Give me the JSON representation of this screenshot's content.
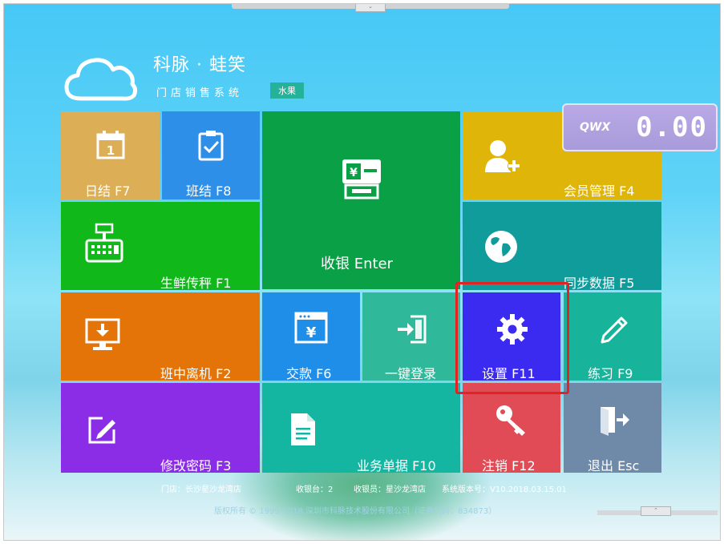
{
  "brand": {
    "title": "科脉 · 蛙笑",
    "subtitle": "门店销售系统",
    "badge": "水果"
  },
  "display": {
    "logo": "QWX",
    "amount": "0.00"
  },
  "tiles": {
    "daily": "日结 F7",
    "shift": "班结 F8",
    "checkout": "收银 Enter",
    "member": "会员管理 F4",
    "scale": "生鲜传秤 F1",
    "sync": "同步数据 F5",
    "leave": "班中离机 F2",
    "payin": "交款 F6",
    "login": "一键登录",
    "settings": "设置 F11",
    "practice": "练习 F9",
    "password": "修改密码 F3",
    "docs": "业务单据 F10",
    "logout": "注销 F12",
    "exit": "退出 Esc"
  },
  "status": {
    "store": "门店：长沙星沙龙湾店",
    "register": "收银台：2",
    "cashier": "收银员：星沙龙湾店",
    "version": "系统版本号：V10.2018.03.15.01"
  },
  "copyright": "版权所有 © 1999-2018 深圳市科脉技术股份有限公司（证券代码：834873）",
  "colors": {
    "daily": "#dcae55",
    "shift": "#2e8fe8",
    "checkout": "#0aa046",
    "member": "#e0b50a",
    "scale": "#10b81a",
    "sync": "#119c9c",
    "leave": "#e47408",
    "payin": "#1f8ee8",
    "login": "#30b89a",
    "settings": "#3b2bf0",
    "practice": "#17b39a",
    "password": "#8b2de6",
    "docs": "#14b6a2",
    "logout": "#e04b56",
    "exit": "#6e8aa8"
  }
}
